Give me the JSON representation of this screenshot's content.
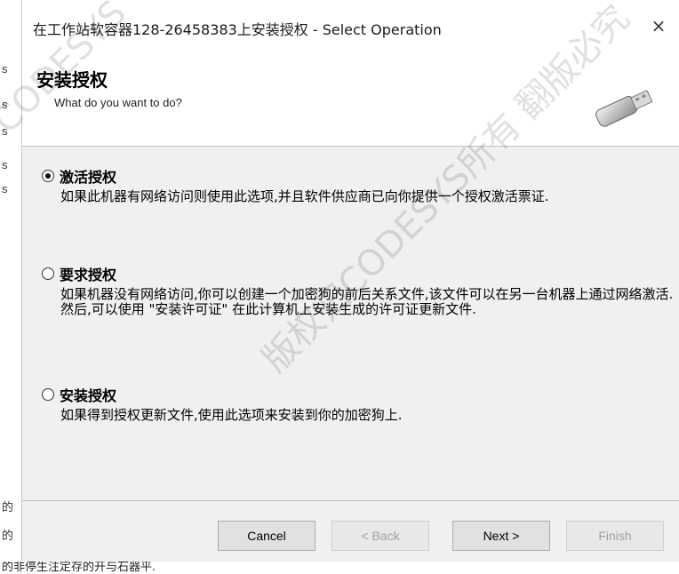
{
  "background_window": {
    "letters": [
      "s",
      "s",
      "s",
      "s",
      "s"
    ],
    "bottom_chars": [
      "的",
      "的"
    ],
    "bottom_strip_text": "的非停生注定存的开与石器平."
  },
  "dialog": {
    "title": "在工作站软容器128-26458383上安装授权 - Select Operation",
    "close_label": "×"
  },
  "header": {
    "title": "安装授权",
    "subtitle": "What do you want to do?"
  },
  "options": [
    {
      "label": "激活授权",
      "checked": true,
      "description": "如果此机器有网络访问则使用此选项,并且软件供应商已向你提供一个授权激活票证."
    },
    {
      "label": "要求授权",
      "checked": false,
      "description": "如果机器没有网络访问,你可以创建一个加密狗的前后关系文件,该文件可以在另一台机器上通过网络激活.然后,可以使用 \"安装许可证\" 在此计算机上安装生成的许可证更新文件."
    },
    {
      "label": "安装授权",
      "checked": false,
      "description": "如果得到授权更新文件,使用此选项来安装到你的加密狗上."
    }
  ],
  "buttons": {
    "cancel": "Cancel",
    "back": "< Back",
    "next": "Next >",
    "finish": "Finish"
  },
  "watermark": {
    "text_main": "版权归CODESYS所有 翻版必究",
    "text_top": "CODESYS"
  }
}
